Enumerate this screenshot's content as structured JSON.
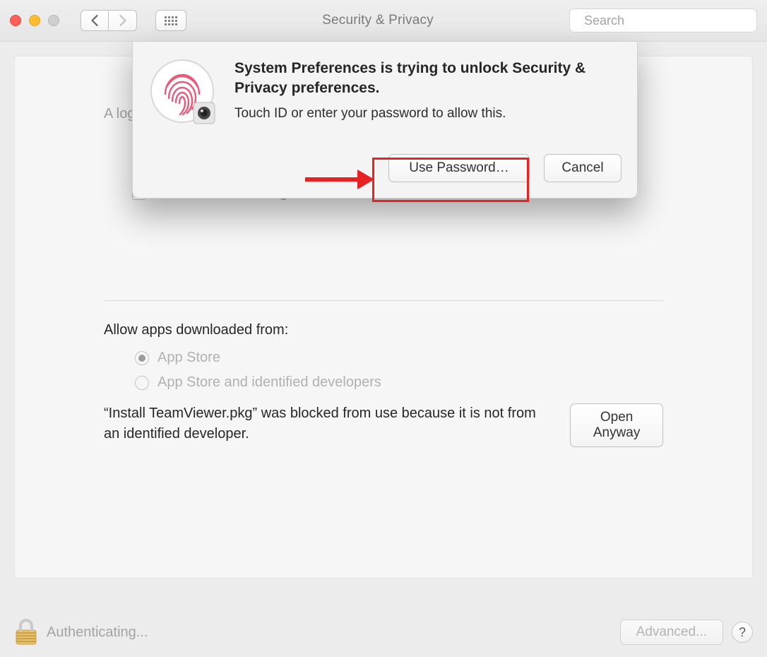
{
  "window": {
    "title": "Security & Privacy"
  },
  "search": {
    "placeholder": "Search"
  },
  "login_section": {
    "prefix_visible": "A log",
    "checkbox_label_fragment": "s",
    "disable_auto_login_label": "Disable automatic login"
  },
  "allow_section": {
    "heading": "Allow apps downloaded from:",
    "option_app_store": "App Store",
    "option_identified": "App Store and identified developers",
    "blocked_text": "“Install TeamViewer.pkg” was blocked from use because it is not from an identified developer.",
    "open_anyway": "Open Anyway"
  },
  "footer": {
    "status": "Authenticating...",
    "advanced": "Advanced...",
    "help": "?"
  },
  "dialog": {
    "heading": "System Preferences is trying to unlock Security & Privacy preferences.",
    "subtext": "Touch ID or enter your password to allow this.",
    "use_password": "Use Password…",
    "cancel": "Cancel"
  }
}
